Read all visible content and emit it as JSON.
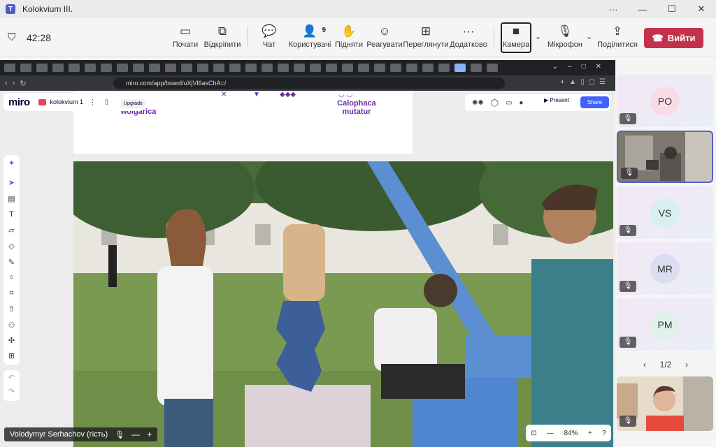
{
  "window": {
    "title": "Kolokvium III.",
    "controls": [
      "···",
      "—",
      "☐",
      "✕"
    ]
  },
  "meeting": {
    "timer": "42:28",
    "buttons": {
      "start": "Почати",
      "popout": "Відкріпити",
      "chat": "Чат",
      "people": "Користувачі",
      "people_count": "9",
      "raise": "Підняти",
      "react": "Реагувати",
      "view": "Переглянути",
      "more": "Додатково",
      "camera": "Камера",
      "mic": "Мікрофон",
      "share": "Поділитися",
      "leave": "Вийти"
    }
  },
  "browser": {
    "url": "miro.com/app/board/uXjVl6asChA=/"
  },
  "miro": {
    "logo": "miro",
    "board_name": "kolokvium 1",
    "upgrade": "Upgrade",
    "present": "Present",
    "share": "Share",
    "label_left_1": "aca",
    "label_left_2": "wolgarica",
    "label_right_1": "Calophaca",
    "label_right_2": "mutatur",
    "zoom": "84%"
  },
  "presenter": {
    "name": "Volodymyr Serhachov (гість)"
  },
  "participants": [
    {
      "initials": "PO",
      "muted": true,
      "avatar_color": "#f8dbe6"
    },
    {
      "initials": "",
      "muted": true,
      "video": true
    },
    {
      "initials": "VS",
      "muted": true,
      "avatar_color": "#d9efee"
    },
    {
      "initials": "MR",
      "muted": true,
      "avatar_color": "#dcdcf3"
    },
    {
      "initials": "PM",
      "muted": true,
      "avatar_color": "#dff1e8"
    }
  ],
  "pager": {
    "text": "1/2"
  },
  "colors": {
    "leave": "#c4314b",
    "teams_accent": "#5b5fc7",
    "miro_blue": "#4262ff",
    "label_purple": "#6b2fa8"
  }
}
